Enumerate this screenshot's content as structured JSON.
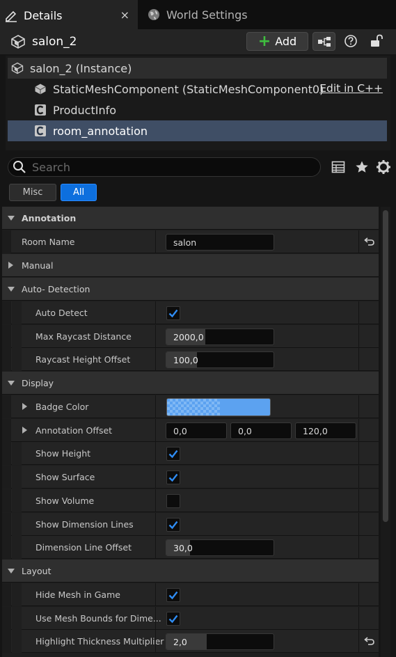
{
  "tabs": [
    {
      "label": "Details",
      "icon": "pencil-icon",
      "active": true
    },
    {
      "label": "World Settings",
      "icon": "globe-icon",
      "active": false
    }
  ],
  "tab_close": "×",
  "header": {
    "actor_name": "salon_2",
    "add_label": "Add",
    "add_plus": "+"
  },
  "tree": {
    "root": "salon_2 (Instance)",
    "items": [
      {
        "label": "StaticMeshComponent (StaticMeshComponent0)",
        "icon": "mesh-cube-icon",
        "action": "Edit in C++"
      },
      {
        "label": "ProductInfo",
        "icon": "csharp-class-icon"
      },
      {
        "label": "room_annotation",
        "icon": "csharp-class-icon",
        "selected": true
      }
    ]
  },
  "search": {
    "placeholder": "Search",
    "value": ""
  },
  "categories": {
    "misc": "Misc",
    "all": "All"
  },
  "props": {
    "annotation": "Annotation",
    "room_name": "Room Name",
    "room_name_value": "salon",
    "manual": "Manual",
    "auto_detection": "Auto- Detection",
    "auto_detect": "Auto Detect",
    "max_raycast": "Max Raycast Distance",
    "max_raycast_value": "2000,0",
    "raycast_height": "Raycast Height Offset",
    "raycast_height_value": "100,0",
    "display": "Display",
    "badge_color": "Badge Color",
    "badge_color_hex": "#5ca2f0",
    "annotation_offset": "Annotation Offset",
    "offset_x": "0,0",
    "offset_y": "0,0",
    "offset_z": "120,0",
    "show_height": "Show Height",
    "show_surface": "Show Surface",
    "show_volume": "Show Volume",
    "show_dimension_lines": "Show Dimension Lines",
    "dimension_line_offset": "Dimension Line Offset",
    "dimension_line_offset_value": "30,0",
    "layout": "Layout",
    "hide_mesh": "Hide Mesh in Game",
    "use_mesh_bounds": "Use Mesh Bounds for Dime...",
    "highlight_thickness": "Highlight Thickness Multiplier",
    "highlight_thickness_value": "2,0"
  },
  "checks": {
    "auto_detect": true,
    "show_height": true,
    "show_surface": true,
    "show_volume": false,
    "show_dimension_lines": true,
    "hide_mesh": true,
    "use_mesh_bounds": true
  },
  "colors": {
    "accent": "#0d6fde",
    "check": "#2f8df5",
    "selected_row": "#3f4e65"
  }
}
